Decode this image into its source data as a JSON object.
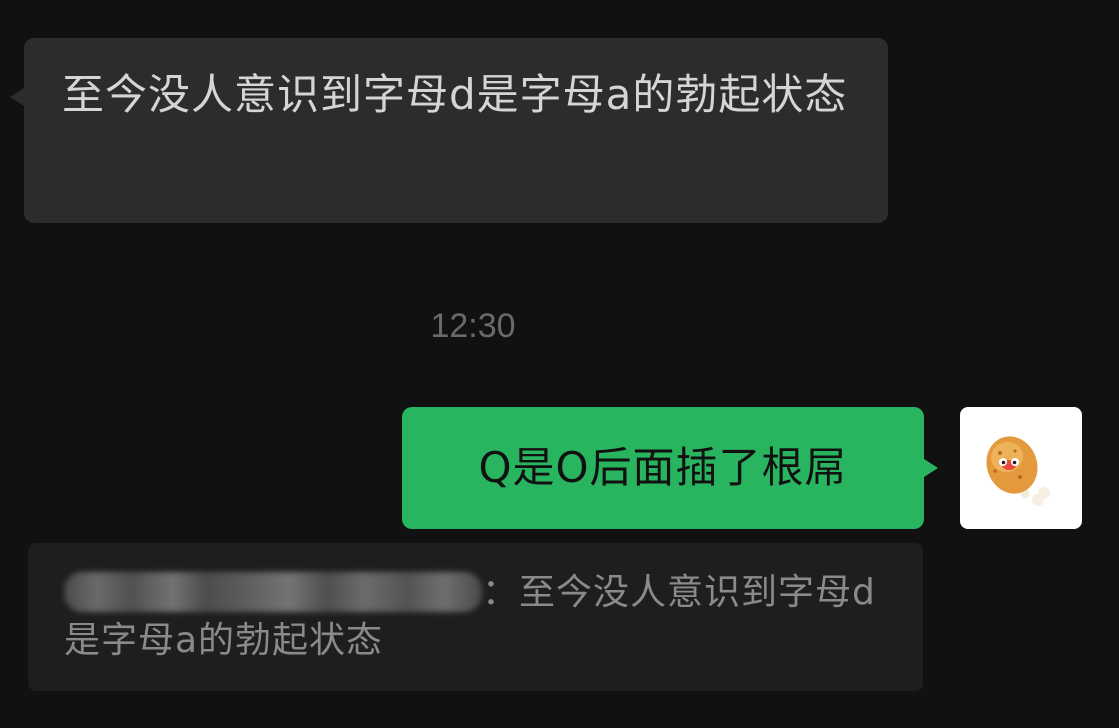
{
  "messages": {
    "incoming": {
      "text": "至今没人意识到字母d是字母a的勃起状态",
      "bubble_color": "#2c2c2c"
    },
    "timestamp": "12:30",
    "outgoing": {
      "text": "Q是O后面插了根屌",
      "bubble_color": "#29b55f",
      "avatar_icon": "chicken-drumstick-avatar-icon"
    },
    "quote": {
      "author_redacted": true,
      "separator": "：",
      "text": "至今没人意识到字母d是字母a的勃起状态"
    }
  },
  "colors": {
    "background": "#111111",
    "quote_background": "#1e1e1e"
  }
}
